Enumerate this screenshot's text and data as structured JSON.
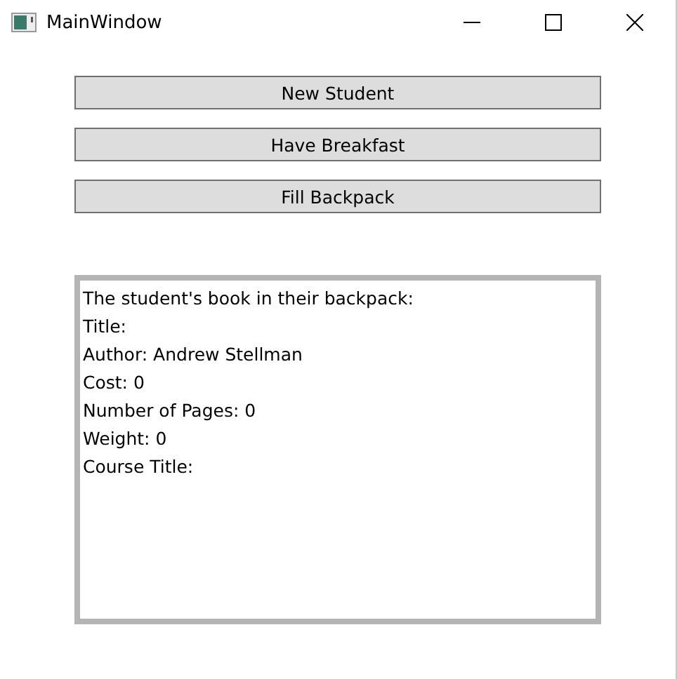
{
  "window": {
    "title": "MainWindow"
  },
  "buttons": [
    "New Student",
    "Have Breakfast",
    "Fill Backpack"
  ],
  "output": {
    "lines": [
      "The student's book in their backpack:",
      "Title:",
      "Author: Andrew Stellman",
      "Cost: 0",
      "Number of Pages: 0",
      "Weight: 0",
      "Course Title:"
    ]
  }
}
